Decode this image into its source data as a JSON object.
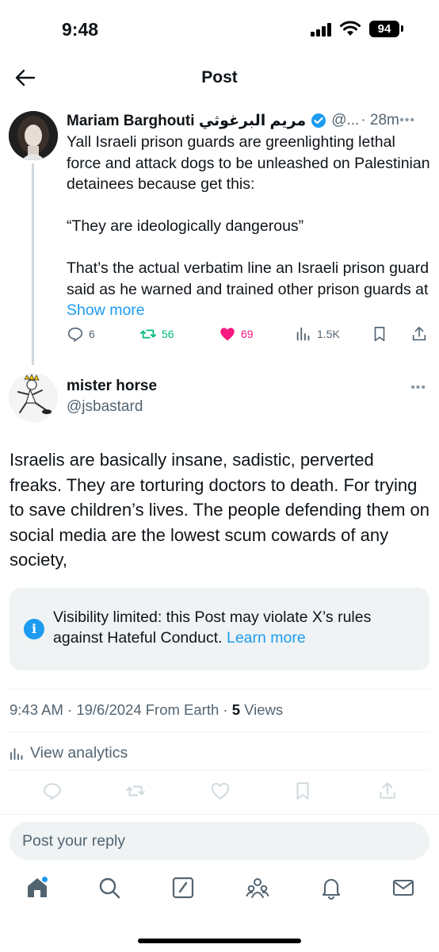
{
  "status_bar": {
    "time": "9:48",
    "battery": "94"
  },
  "header": {
    "title": "Post"
  },
  "parent_post": {
    "author_name": "Mariam Barghouti مريم البرغوثي",
    "handle": "@...",
    "time": "· 28m",
    "text": "Yall Israeli prison guards are greenlighting lethal force and attack dogs to be unleashed on Palestinian detainees because get this:\n\n“They are ideologically dangerous”\n\nThat’s the actual verbatim line an Israeli prison guard said as he warned and trained other prison guards at ",
    "show_more": "Show more",
    "replies": "6",
    "reposts": "56",
    "likes": "69",
    "views": "1.5K"
  },
  "reply_post": {
    "author_name": "mister horse",
    "handle": "@jsbastard",
    "text": "Israelis are basically insane, sadistic, perverted freaks. They are torturing doctors to death. For trying to save children’s lives. The people defending them on social media are the lowest scum cowards of any society,",
    "notice": "Visibility limited: this Post may violate X’s rules against Hateful Conduct. ",
    "learn_more": "Learn more",
    "timestamp": "9:43 AM · 19/6/2024 From Earth · ",
    "views_count": "5",
    "views_label": " Views",
    "analytics": "View analytics"
  },
  "reply_box": {
    "placeholder": "Post your reply"
  },
  "colors": {
    "accent": "#1d9bf0",
    "repost": "#00ba7c",
    "like": "#f91880",
    "muted": "#536471"
  },
  "icons": [
    "back-arrow-icon",
    "verified-icon",
    "more-icon",
    "reply-icon",
    "repost-icon",
    "like-icon",
    "views-icon",
    "bookmark-icon",
    "share-icon",
    "info-icon",
    "analytics-icon",
    "home-icon",
    "search-icon",
    "compose-icon",
    "communities-icon",
    "bell-icon",
    "mail-icon"
  ]
}
